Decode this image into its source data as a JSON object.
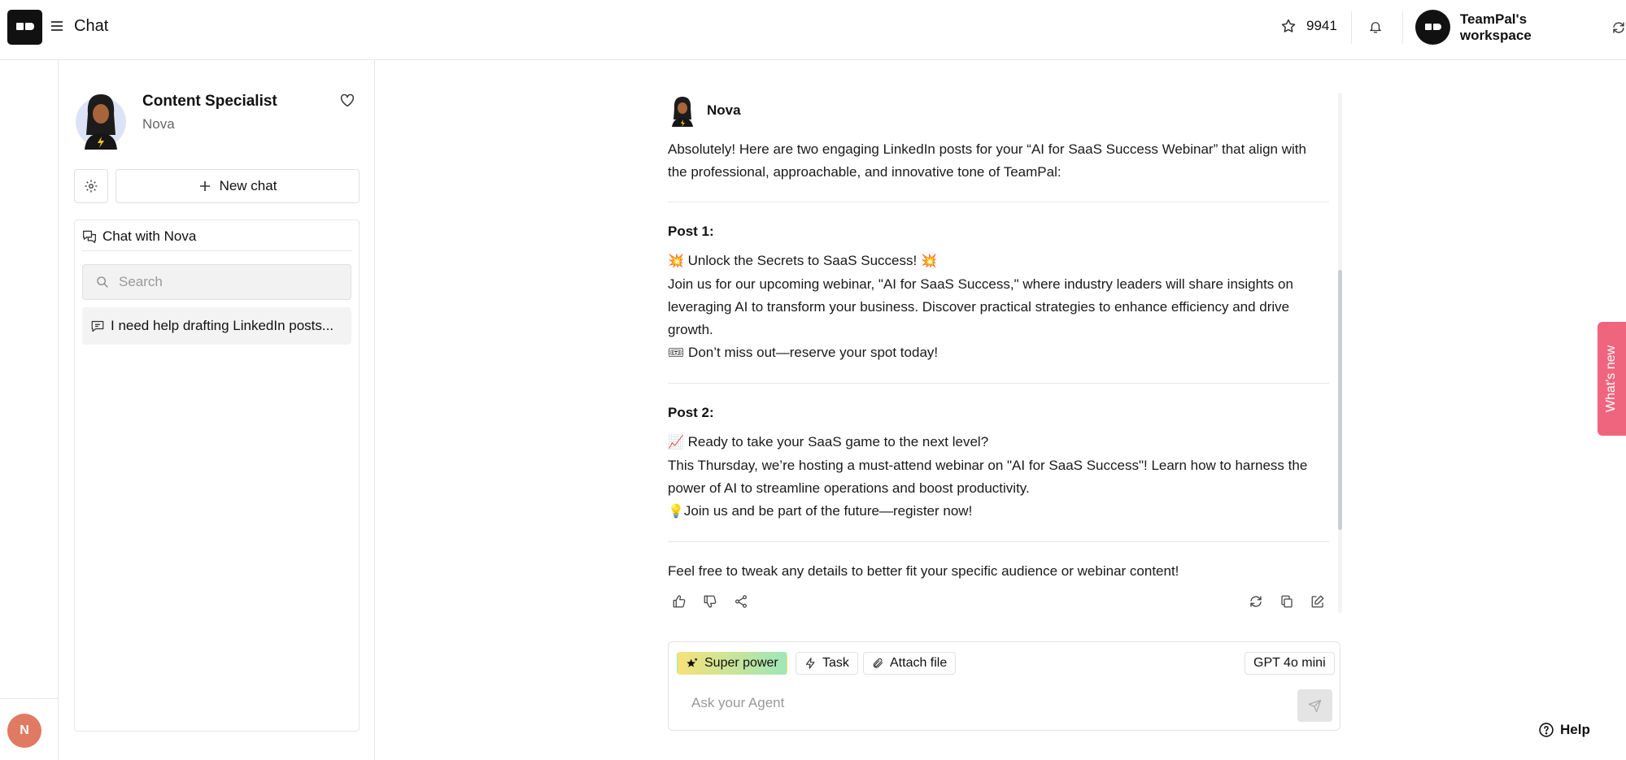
{
  "header": {
    "title": "Chat",
    "stars_count": "9941",
    "workspace_name": "TeamPal's workspace"
  },
  "rail": {
    "user_initial": "N"
  },
  "agent": {
    "title": "Content Specialist",
    "name": "Nova",
    "new_chat_label": "New chat",
    "list_title": "Chat with Nova",
    "search_placeholder": "Search",
    "conversations": [
      {
        "label": "I need help drafting LinkedIn posts..."
      }
    ]
  },
  "message": {
    "sender": "Nova",
    "intro": "Absolutely! Here are two engaging LinkedIn posts for your “AI for SaaS Success Webinar” that align with the professional, approachable, and innovative tone of TeamPal:",
    "post1": {
      "title": "Post 1:",
      "headline_emoji": "💥",
      "headline": "Unlock the Secrets to SaaS Success!",
      "body": "Join us for our upcoming webinar, \"AI for SaaS Success,\" where industry leaders will share insights on leveraging AI to transform your business. Discover practical strategies to enhance efficiency and drive growth.",
      "cta_emoji": "🎟",
      "cta": "Don’t miss out—reserve your spot today!"
    },
    "post2": {
      "title": "Post 2:",
      "headline_emoji": "📈",
      "headline": "Ready to take your SaaS game to the next level?",
      "body": "This Thursday, we’re hosting a must-attend webinar on \"AI for SaaS Success\"! Learn how to harness the power of AI to streamline operations and boost productivity.",
      "cta_emoji": "💡",
      "cta": "Join us and be part of the future—register now!"
    },
    "outro": "Feel free to tweak any details to better fit your specific audience or webinar content!"
  },
  "composer": {
    "super_power_label": "Super power",
    "task_label": "Task",
    "attach_label": "Attach file",
    "model_label": "GPT 4o mini",
    "placeholder": "Ask your Agent"
  },
  "whats_new_label": "What's new",
  "help_label": "Help"
}
